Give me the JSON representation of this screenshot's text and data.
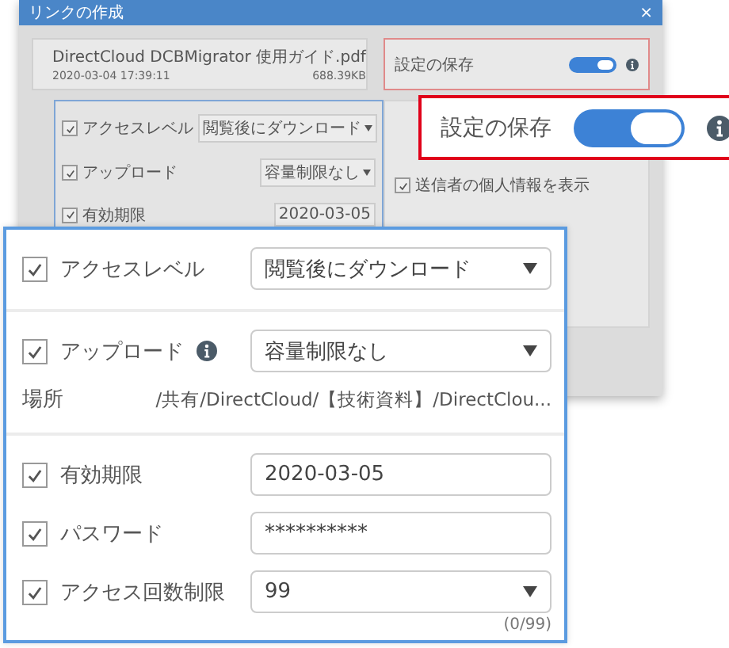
{
  "dialog": {
    "title": "リンクの作成",
    "close": "×",
    "file": {
      "name": "DirectCloud DCBMigrator 使用ガイド.pdf",
      "date": "2020-03-04 17:39:11",
      "size": "688.39KB"
    },
    "save_settings": {
      "label": "設定の保存",
      "on": true
    },
    "settings": [
      {
        "label": "アクセスレベル",
        "checked": true,
        "value": "閲覧後にダウンロード",
        "kind": "select"
      },
      {
        "label": "アップロード",
        "checked": true,
        "value": "容量制限なし",
        "kind": "select"
      },
      {
        "label": "有効期限",
        "checked": true,
        "value": "2020-03-05",
        "kind": "input"
      }
    ],
    "options": [
      {
        "label": "送信者の個人情報を表示",
        "checked": true
      }
    ]
  },
  "zoom_save": {
    "label": "設定の保存",
    "on": true
  },
  "zoom_settings": {
    "sections": [
      {
        "rows": [
          {
            "kind": "select",
            "label": "アクセスレベル",
            "checked": true,
            "value": "閲覧後にダウンロード"
          }
        ]
      },
      {
        "rows": [
          {
            "kind": "select",
            "label": "アップロード",
            "checked": true,
            "value": "容量制限なし",
            "info": true
          },
          {
            "kind": "path",
            "label": "場所",
            "value": "/共有/DirectCloud/【技術資料】/DirectClou..."
          }
        ]
      },
      {
        "rows": [
          {
            "kind": "input",
            "label": "有効期限",
            "checked": true,
            "value": "2020-03-05"
          },
          {
            "kind": "input",
            "label": "パスワード",
            "checked": true,
            "value": "**********"
          },
          {
            "kind": "select",
            "label": "アクセス回数制限",
            "checked": true,
            "value": "99",
            "counter": "(0/99)"
          }
        ]
      }
    ]
  }
}
